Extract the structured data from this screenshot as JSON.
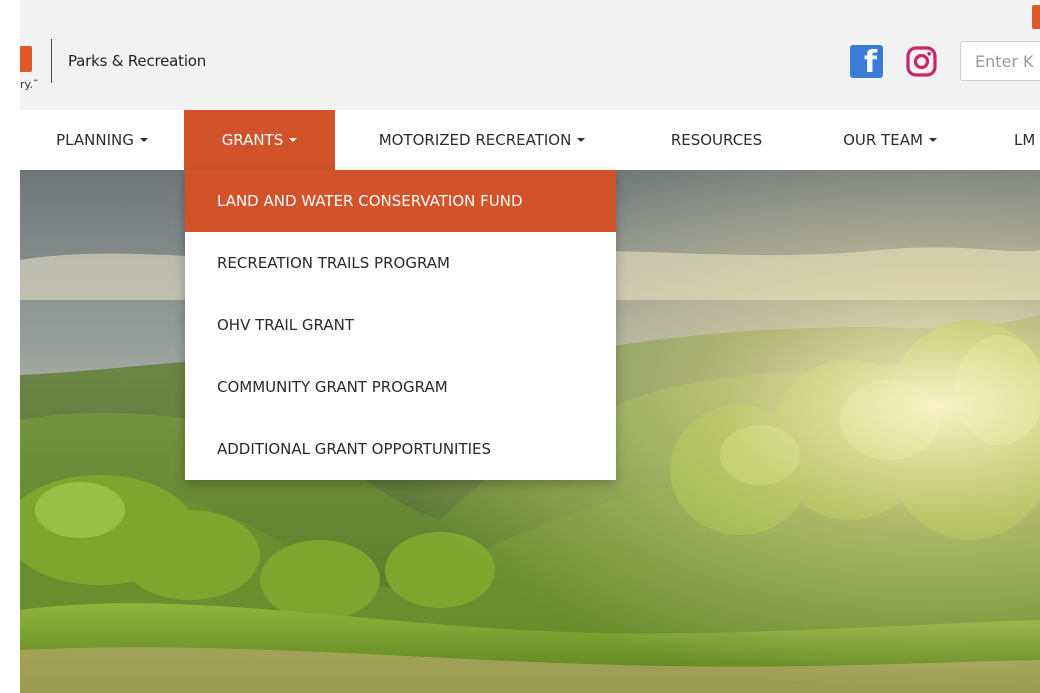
{
  "header": {
    "brand_name": "Parks & Recreation",
    "tagline_fragment": "ry.˜",
    "search_placeholder": "Enter K",
    "social_icons": [
      "facebook-icon",
      "instagram-icon"
    ]
  },
  "nav": {
    "items": [
      {
        "label": "PLANNING",
        "has_dropdown": true
      },
      {
        "label": "GRANTS",
        "has_dropdown": true,
        "active": true
      },
      {
        "label": "MOTORIZED RECREATION",
        "has_dropdown": true
      },
      {
        "label": "RESOURCES",
        "has_dropdown": false
      },
      {
        "label": "OUR TEAM",
        "has_dropdown": true
      },
      {
        "label": "LM",
        "has_dropdown": false
      }
    ]
  },
  "grants_dropdown": {
    "items": [
      {
        "label": "LAND AND WATER CONSERVATION FUND",
        "active": true
      },
      {
        "label": "RECREATION TRAILS PROGRAM"
      },
      {
        "label": "OHV TRAIL GRANT"
      },
      {
        "label": "COMMUNITY GRANT PROGRAM"
      },
      {
        "label": "ADDITIONAL GRANT OPPORTUNITIES"
      }
    ]
  },
  "colors": {
    "accent": "#d2522a",
    "header_bg": "#f2f2f2",
    "facebook": "#3b7bd6",
    "instagram": "#c8246a"
  }
}
